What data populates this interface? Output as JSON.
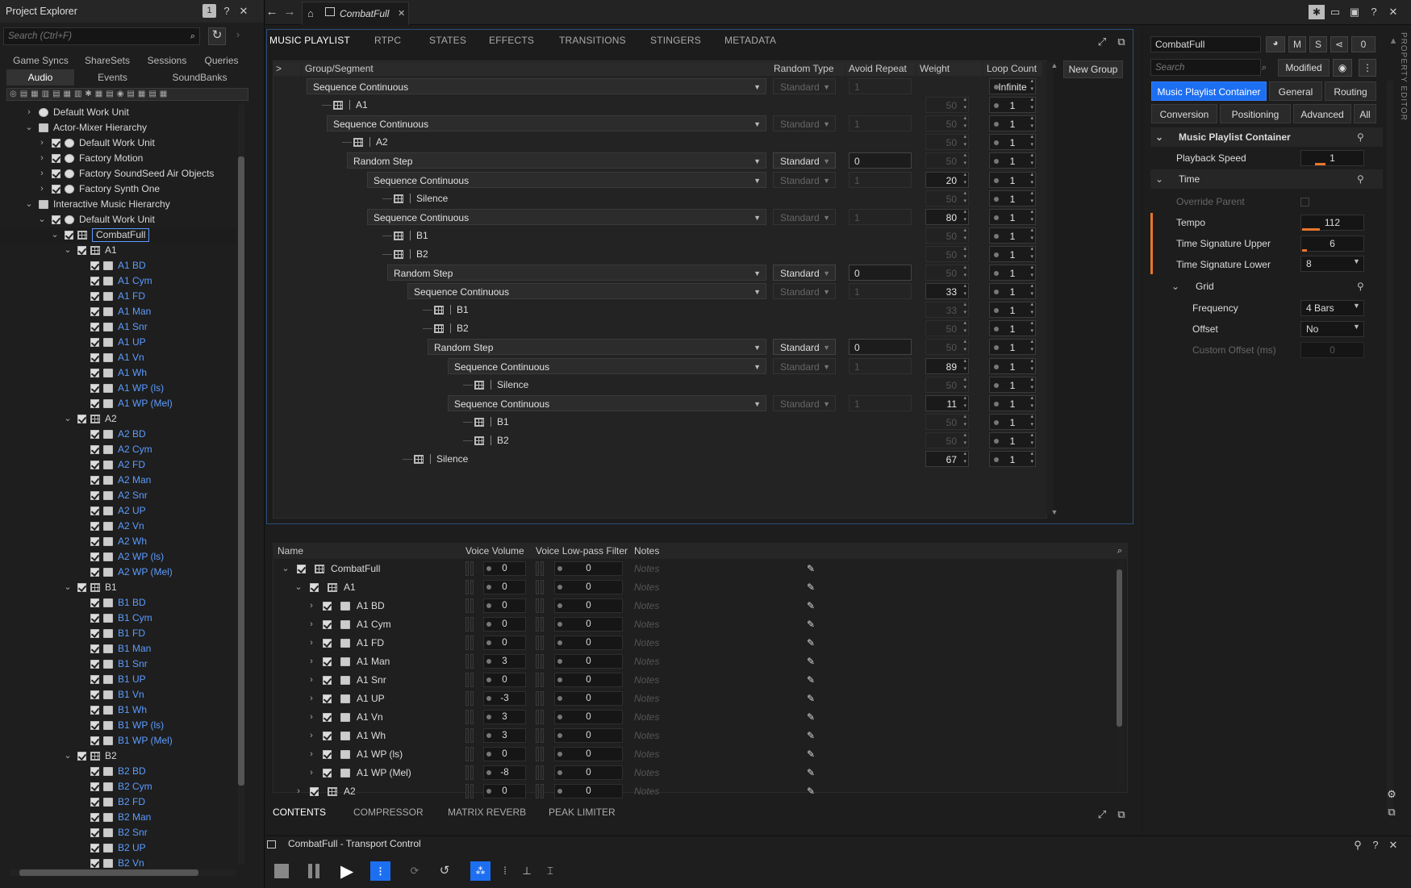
{
  "project_explorer": {
    "title": "Project Explorer",
    "badge": "1",
    "search_placeholder": "Search (Ctrl+F)",
    "tabs_row1": [
      "Game Syncs",
      "ShareSets",
      "Sessions",
      "Queries"
    ],
    "tabs_row2": [
      "Audio",
      "Events",
      "SoundBanks"
    ],
    "tree": [
      {
        "label": "Default Work Unit",
        "icon": "work-unit-icon",
        "indent": 0,
        "chev": "›",
        "cb": false,
        "blue": false
      },
      {
        "label": "Actor-Mixer Hierarchy",
        "icon": "folder-icon",
        "indent": 0,
        "chev": "⌄",
        "cb": false,
        "blue": false
      },
      {
        "label": "Default Work Unit",
        "icon": "work-unit-icon",
        "indent": 1,
        "chev": "›",
        "cb": true,
        "blue": false
      },
      {
        "label": "Factory Motion",
        "icon": "work-unit-icon",
        "indent": 1,
        "chev": "›",
        "cb": true,
        "blue": false
      },
      {
        "label": "Factory SoundSeed Air Objects",
        "icon": "work-unit-icon",
        "indent": 1,
        "chev": "›",
        "cb": true,
        "blue": false
      },
      {
        "label": "Factory Synth One",
        "icon": "work-unit-icon",
        "indent": 1,
        "chev": "›",
        "cb": true,
        "blue": false
      },
      {
        "label": "Interactive Music Hierarchy",
        "icon": "folder-icon",
        "indent": 0,
        "chev": "⌄",
        "cb": false,
        "blue": false
      },
      {
        "label": "Default Work Unit",
        "icon": "work-unit-icon",
        "indent": 1,
        "chev": "⌄",
        "cb": true,
        "blue": false
      },
      {
        "label": "CombatFull",
        "icon": "playlist-icon",
        "indent": 2,
        "chev": "⌄",
        "cb": true,
        "blue": false,
        "selected": true
      },
      {
        "label": "A1",
        "icon": "segment-icon",
        "indent": 3,
        "chev": "⌄",
        "cb": true,
        "blue": false
      },
      {
        "label": "A1 BD",
        "icon": "track-icon",
        "indent": 4,
        "chev": "",
        "cb": true,
        "blue": true
      },
      {
        "label": "A1 Cym",
        "icon": "track-icon",
        "indent": 4,
        "chev": "",
        "cb": true,
        "blue": true
      },
      {
        "label": "A1 FD",
        "icon": "track-icon",
        "indent": 4,
        "chev": "",
        "cb": true,
        "blue": true
      },
      {
        "label": "A1 Man",
        "icon": "track-multi-icon",
        "indent": 4,
        "chev": "",
        "cb": true,
        "blue": true
      },
      {
        "label": "A1 Snr",
        "icon": "track-multi-icon",
        "indent": 4,
        "chev": "",
        "cb": true,
        "blue": true
      },
      {
        "label": "A1 UP",
        "icon": "track-multi-icon",
        "indent": 4,
        "chev": "",
        "cb": true,
        "blue": true
      },
      {
        "label": "A1 Vn",
        "icon": "track-multi-icon",
        "indent": 4,
        "chev": "",
        "cb": true,
        "blue": true
      },
      {
        "label": "A1 Wh",
        "icon": "track-multi-icon",
        "indent": 4,
        "chev": "",
        "cb": true,
        "blue": true
      },
      {
        "label": "A1 WP (ls)",
        "icon": "track-icon",
        "indent": 4,
        "chev": "",
        "cb": true,
        "blue": true
      },
      {
        "label": "A1 WP (Mel)",
        "icon": "track-multi-icon",
        "indent": 4,
        "chev": "",
        "cb": true,
        "blue": true
      },
      {
        "label": "A2",
        "icon": "segment-icon",
        "indent": 3,
        "chev": "⌄",
        "cb": true,
        "blue": false
      },
      {
        "label": "A2 BD",
        "icon": "track-icon",
        "indent": 4,
        "chev": "",
        "cb": true,
        "blue": true
      },
      {
        "label": "A2 Cym",
        "icon": "track-icon",
        "indent": 4,
        "chev": "",
        "cb": true,
        "blue": true
      },
      {
        "label": "A2 FD",
        "icon": "track-icon",
        "indent": 4,
        "chev": "",
        "cb": true,
        "blue": true
      },
      {
        "label": "A2 Man",
        "icon": "track-multi-icon",
        "indent": 4,
        "chev": "",
        "cb": true,
        "blue": true
      },
      {
        "label": "A2 Snr",
        "icon": "track-multi-icon",
        "indent": 4,
        "chev": "",
        "cb": true,
        "blue": true
      },
      {
        "label": "A2 UP",
        "icon": "track-multi-icon",
        "indent": 4,
        "chev": "",
        "cb": true,
        "blue": true
      },
      {
        "label": "A2 Vn",
        "icon": "track-multi-icon",
        "indent": 4,
        "chev": "",
        "cb": true,
        "blue": true
      },
      {
        "label": "A2 Wh",
        "icon": "track-multi-icon",
        "indent": 4,
        "chev": "",
        "cb": true,
        "blue": true
      },
      {
        "label": "A2 WP (ls)",
        "icon": "track-icon",
        "indent": 4,
        "chev": "",
        "cb": true,
        "blue": true
      },
      {
        "label": "A2 WP (Mel)",
        "icon": "track-multi-icon",
        "indent": 4,
        "chev": "",
        "cb": true,
        "blue": true
      },
      {
        "label": "B1",
        "icon": "segment-icon",
        "indent": 3,
        "chev": "⌄",
        "cb": true,
        "blue": false
      },
      {
        "label": "B1 BD",
        "icon": "track-icon",
        "indent": 4,
        "chev": "",
        "cb": true,
        "blue": true
      },
      {
        "label": "B1 Cym",
        "icon": "track-icon",
        "indent": 4,
        "chev": "",
        "cb": true,
        "blue": true
      },
      {
        "label": "B1 FD",
        "icon": "track-icon",
        "indent": 4,
        "chev": "",
        "cb": true,
        "blue": true
      },
      {
        "label": "B1 Man",
        "icon": "track-multi-icon",
        "indent": 4,
        "chev": "",
        "cb": true,
        "blue": true
      },
      {
        "label": "B1 Snr",
        "icon": "track-multi-icon",
        "indent": 4,
        "chev": "",
        "cb": true,
        "blue": true
      },
      {
        "label": "B1 UP",
        "icon": "track-multi-icon",
        "indent": 4,
        "chev": "",
        "cb": true,
        "blue": true
      },
      {
        "label": "B1 Vn",
        "icon": "track-multi-icon",
        "indent": 4,
        "chev": "",
        "cb": true,
        "blue": true
      },
      {
        "label": "B1 Wh",
        "icon": "track-multi-icon",
        "indent": 4,
        "chev": "",
        "cb": true,
        "blue": true
      },
      {
        "label": "B1 WP (ls)",
        "icon": "track-icon",
        "indent": 4,
        "chev": "",
        "cb": true,
        "blue": true
      },
      {
        "label": "B1 WP (Mel)",
        "icon": "track-multi-icon",
        "indent": 4,
        "chev": "",
        "cb": true,
        "blue": true
      },
      {
        "label": "B2",
        "icon": "segment-icon",
        "indent": 3,
        "chev": "⌄",
        "cb": true,
        "blue": false
      },
      {
        "label": "B2 BD",
        "icon": "track-icon",
        "indent": 4,
        "chev": "",
        "cb": true,
        "blue": true
      },
      {
        "label": "B2 Cym",
        "icon": "track-icon",
        "indent": 4,
        "chev": "",
        "cb": true,
        "blue": true
      },
      {
        "label": "B2 FD",
        "icon": "track-icon",
        "indent": 4,
        "chev": "",
        "cb": true,
        "blue": true
      },
      {
        "label": "B2 Man",
        "icon": "track-multi-icon",
        "indent": 4,
        "chev": "",
        "cb": true,
        "blue": true
      },
      {
        "label": "B2 Snr",
        "icon": "track-multi-icon",
        "indent": 4,
        "chev": "",
        "cb": true,
        "blue": true
      },
      {
        "label": "B2 UP",
        "icon": "track-multi-icon",
        "indent": 4,
        "chev": "",
        "cb": true,
        "blue": true
      },
      {
        "label": "B2 Vn",
        "icon": "track-multi-icon",
        "indent": 4,
        "chev": "",
        "cb": true,
        "blue": true
      }
    ]
  },
  "editor": {
    "tab_title": "CombatFull",
    "tabs": [
      "MUSIC PLAYLIST",
      "RTPC",
      "STATES",
      "EFFECTS",
      "TRANSITIONS",
      "STINGERS",
      "METADATA"
    ],
    "columns": {
      "expand": ">",
      "group": "Group/Segment",
      "random": "Random Type",
      "avoid": "Avoid Repeat",
      "weight": "Weight",
      "loop": "Loop Count"
    },
    "new_group": "New Group",
    "rows": [
      {
        "kind": "group",
        "label": "Sequence Continuous",
        "depth": 0,
        "rt": "Standard",
        "rt_on": false,
        "ar": "1",
        "ar_on": false,
        "wt": "",
        "wt_on": false,
        "loop": "Infinite"
      },
      {
        "kind": "leaf",
        "label": "A1",
        "depth": 1,
        "wt": "50",
        "wt_on": false,
        "loop": "1"
      },
      {
        "kind": "group",
        "label": "Sequence Continuous",
        "depth": 1,
        "rt": "Standard",
        "rt_on": false,
        "ar": "1",
        "ar_on": false,
        "wt": "50",
        "wt_on": false,
        "loop": "1"
      },
      {
        "kind": "leaf",
        "label": "A2",
        "depth": 2,
        "wt": "50",
        "wt_on": false,
        "loop": "1"
      },
      {
        "kind": "group",
        "label": "Random Step",
        "depth": 2,
        "rt": "Standard",
        "rt_on": true,
        "ar": "0",
        "ar_on": true,
        "wt": "50",
        "wt_on": false,
        "loop": "1"
      },
      {
        "kind": "group",
        "label": "Sequence Continuous",
        "depth": 3,
        "rt": "Standard",
        "rt_on": false,
        "ar": "1",
        "ar_on": false,
        "wt": "20",
        "wt_on": true,
        "loop": "1"
      },
      {
        "kind": "leaf",
        "label": "Silence",
        "depth": 4,
        "wt": "50",
        "wt_on": false,
        "loop": "1"
      },
      {
        "kind": "group",
        "label": "Sequence Continuous",
        "depth": 3,
        "rt": "Standard",
        "rt_on": false,
        "ar": "1",
        "ar_on": false,
        "wt": "80",
        "wt_on": true,
        "loop": "1"
      },
      {
        "kind": "leaf",
        "label": "B1",
        "depth": 4,
        "wt": "50",
        "wt_on": false,
        "loop": "1"
      },
      {
        "kind": "leaf",
        "label": "B2",
        "depth": 4,
        "wt": "50",
        "wt_on": false,
        "loop": "1"
      },
      {
        "kind": "group",
        "label": "Random Step",
        "depth": 4,
        "rt": "Standard",
        "rt_on": true,
        "ar": "0",
        "ar_on": true,
        "wt": "50",
        "wt_on": false,
        "loop": "1"
      },
      {
        "kind": "group",
        "label": "Sequence Continuous",
        "depth": 5,
        "rt": "Standard",
        "rt_on": false,
        "ar": "1",
        "ar_on": false,
        "wt": "33",
        "wt_on": true,
        "loop": "1"
      },
      {
        "kind": "leaf",
        "label": "B1",
        "depth": 6,
        "wt": "33",
        "wt_on": false,
        "loop": "1"
      },
      {
        "kind": "leaf",
        "label": "B2",
        "depth": 6,
        "wt": "50",
        "wt_on": false,
        "loop": "1"
      },
      {
        "kind": "group",
        "label": "Random Step",
        "depth": 6,
        "rt": "Standard",
        "rt_on": true,
        "ar": "0",
        "ar_on": true,
        "wt": "50",
        "wt_on": false,
        "loop": "1"
      },
      {
        "kind": "group",
        "label": "Sequence Continuous",
        "depth": 7,
        "rt": "Standard",
        "rt_on": false,
        "ar": "1",
        "ar_on": false,
        "wt": "89",
        "wt_on": true,
        "loop": "1"
      },
      {
        "kind": "leaf",
        "label": "Silence",
        "depth": 8,
        "wt": "50",
        "wt_on": false,
        "loop": "1"
      },
      {
        "kind": "group",
        "label": "Sequence Continuous",
        "depth": 7,
        "rt": "Standard",
        "rt_on": false,
        "ar": "1",
        "ar_on": false,
        "wt": "11",
        "wt_on": true,
        "loop": "1"
      },
      {
        "kind": "leaf",
        "label": "B1",
        "depth": 8,
        "wt": "50",
        "wt_on": false,
        "loop": "1"
      },
      {
        "kind": "leaf",
        "label": "B2",
        "depth": 8,
        "wt": "50",
        "wt_on": false,
        "loop": "1"
      },
      {
        "kind": "leaf",
        "label": "Silence",
        "depth": 5,
        "wt": "67",
        "wt_on": true,
        "loop": "1"
      }
    ]
  },
  "contents": {
    "columns": [
      "Name",
      "Voice Volume",
      "Voice Low-pass Filter",
      "Notes"
    ],
    "notes_placeholder": "Notes",
    "rows": [
      {
        "label": "CombatFull",
        "depth": 0,
        "chev": "⌄",
        "vol": "0",
        "lpf": "0"
      },
      {
        "label": "A1",
        "depth": 1,
        "chev": "⌄",
        "vol": "0",
        "lpf": "0"
      },
      {
        "label": "A1 BD",
        "depth": 2,
        "chev": "›",
        "vol": "0",
        "lpf": "0"
      },
      {
        "label": "A1 Cym",
        "depth": 2,
        "chev": "›",
        "vol": "0",
        "lpf": "0"
      },
      {
        "label": "A1 FD",
        "depth": 2,
        "chev": "›",
        "vol": "0",
        "lpf": "0"
      },
      {
        "label": "A1 Man",
        "depth": 2,
        "chev": "›",
        "vol": "3",
        "lpf": "0"
      },
      {
        "label": "A1 Snr",
        "depth": 2,
        "chev": "›",
        "vol": "0",
        "lpf": "0"
      },
      {
        "label": "A1 UP",
        "depth": 2,
        "chev": "›",
        "vol": "-3",
        "lpf": "0"
      },
      {
        "label": "A1 Vn",
        "depth": 2,
        "chev": "›",
        "vol": "3",
        "lpf": "0"
      },
      {
        "label": "A1 Wh",
        "depth": 2,
        "chev": "›",
        "vol": "3",
        "lpf": "0"
      },
      {
        "label": "A1 WP (ls)",
        "depth": 2,
        "chev": "›",
        "vol": "0",
        "lpf": "0"
      },
      {
        "label": "A1 WP (Mel)",
        "depth": 2,
        "chev": "›",
        "vol": "-8",
        "lpf": "0"
      },
      {
        "label": "A2",
        "depth": 1,
        "chev": "›",
        "vol": "0",
        "lpf": "0"
      }
    ]
  },
  "bottom_tabs": [
    "CONTENTS",
    "COMPRESSOR",
    "MATRIX REVERB",
    "PEAK LIMITER"
  ],
  "transport": {
    "title": "CombatFull - Transport Control"
  },
  "property": {
    "name": "CombatFull",
    "mute": "M",
    "solo": "S",
    "count": "0",
    "search_placeholder": "Search",
    "modified": "Modified",
    "tabs1": [
      "Music Playlist Container",
      "General",
      "Routing"
    ],
    "tabs2": [
      "Conversion",
      "Positioning",
      "Advanced",
      "All"
    ],
    "side_label": "PROPERTY EDITOR",
    "section": "Music Playlist Container",
    "playback_speed": {
      "label": "Playback Speed",
      "value": "1"
    },
    "time": "Time",
    "override_parent": "Override Parent",
    "tempo": {
      "label": "Tempo",
      "value": "112"
    },
    "ts_upper": {
      "label": "Time Signature Upper",
      "value": "6"
    },
    "ts_lower": {
      "label": "Time Signature Lower",
      "value": "8"
    },
    "grid": "Grid",
    "frequency": {
      "label": "Frequency",
      "value": "4 Bars"
    },
    "offset": {
      "label": "Offset",
      "value": "No"
    },
    "custom_offset": {
      "label": "Custom Offset (ms)",
      "value": "0"
    }
  }
}
